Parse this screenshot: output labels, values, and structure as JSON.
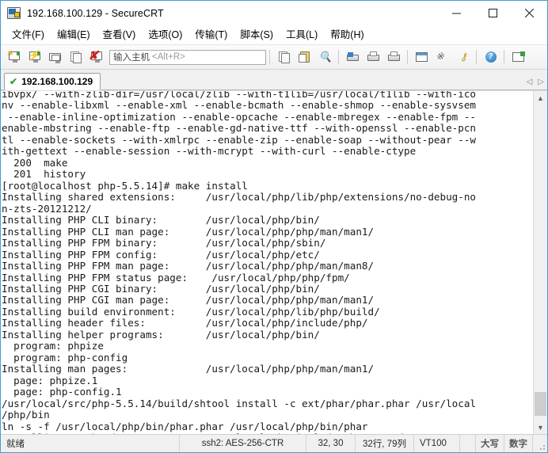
{
  "window": {
    "title": "192.168.100.129 - SecureCRT",
    "icon": "securecrt-icon",
    "controls": {
      "minimize": "–",
      "maximize": "□",
      "close": "✕"
    }
  },
  "menubar": {
    "items": [
      {
        "label": "文件(F)",
        "name": "menu-file"
      },
      {
        "label": "编辑(E)",
        "name": "menu-edit"
      },
      {
        "label": "查看(V)",
        "name": "menu-view"
      },
      {
        "label": "选项(O)",
        "name": "menu-options"
      },
      {
        "label": "传输(T)",
        "name": "menu-transfer"
      },
      {
        "label": "脚本(S)",
        "name": "menu-script"
      },
      {
        "label": "工具(L)",
        "name": "menu-tools"
      },
      {
        "label": "帮助(H)",
        "name": "menu-help"
      }
    ]
  },
  "toolbar": {
    "host_input": {
      "placeholder_cn": "输入主机",
      "placeholder_key": "<Alt+R>",
      "value": ""
    },
    "help_glyph": "?"
  },
  "tabbar": {
    "tabs": [
      {
        "label": "192.168.100.129",
        "status_icon": "✔",
        "active": true
      }
    ],
    "nav_prev": "◁",
    "nav_next": "▷"
  },
  "terminal": {
    "lines": [
      "ibvpx/ --with-zlib-dir=/usr/local/zlib --with-t1lib=/usr/local/t1lib --with-ico",
      "nv --enable-libxml --enable-xml --enable-bcmath --enable-shmop --enable-sysvsem",
      " --enable-inline-optimization --enable-opcache --enable-mbregex --enable-fpm --",
      "enable-mbstring --enable-ftp --enable-gd-native-ttf --with-openssl --enable-pcn",
      "tl --enable-sockets --with-xmlrpc --enable-zip --enable-soap --without-pear --w",
      "ith-gettext --enable-session --with-mcrypt --with-curl --enable-ctype",
      "  200  make",
      "  201  history",
      "[root@localhost php-5.5.14]# make install",
      "Installing shared extensions:     /usr/local/php/lib/php/extensions/no-debug-no",
      "n-zts-20121212/",
      "Installing PHP CLI binary:        /usr/local/php/bin/",
      "Installing PHP CLI man page:      /usr/local/php/php/man/man1/",
      "Installing PHP FPM binary:        /usr/local/php/sbin/",
      "Installing PHP FPM config:        /usr/local/php/etc/",
      "Installing PHP FPM man page:      /usr/local/php/php/man/man8/",
      "Installing PHP FPM status page:    /usr/local/php/php/fpm/",
      "Installing PHP CGI binary:        /usr/local/php/bin/",
      "Installing PHP CGI man page:      /usr/local/php/php/man/man1/",
      "Installing build environment:     /usr/local/php/lib/php/build/",
      "Installing header files:          /usr/local/php/include/php/",
      "Installing helper programs:       /usr/local/php/bin/",
      "  program: phpize",
      "  program: php-config",
      "Installing man pages:             /usr/local/php/php/man/man1/",
      "  page: phpize.1",
      "  page: php-config.1",
      "/usr/local/src/php-5.5.14/build/shtool install -c ext/phar/phar.phar /usr/local",
      "/php/bin",
      "ln -s -f /usr/local/php/bin/phar.phar /usr/local/php/bin/phar",
      "Installing PDO headers:           /usr/local/php/include/php/ext/pdo/"
    ],
    "prompt": "[root@localhost php-5.5.14]# ",
    "cursor": "block"
  },
  "statusbar": {
    "ready": "就绪",
    "cipher": "ssh2: AES-256-CTR",
    "position": "32, 30",
    "size": "32行, 79列",
    "emulation": "VT100",
    "caps": "大写",
    "num": "数字"
  }
}
